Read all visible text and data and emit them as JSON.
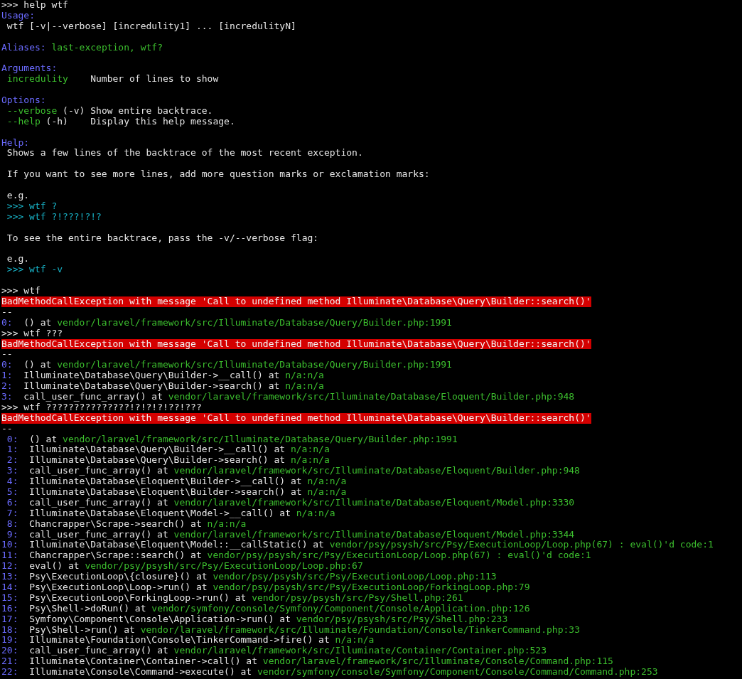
{
  "terminal": {
    "lines": [
      {
        "kind": "text",
        "segments": [
          {
            "kind": "plain",
            "text": ">>> help wtf"
          }
        ]
      },
      {
        "kind": "text",
        "segments": [
          {
            "kind": "heading",
            "text": "Usage:"
          }
        ]
      },
      {
        "kind": "text",
        "indent": true,
        "segments": [
          {
            "kind": "plain",
            "text": "wtf [-v|--verbose] [incredulity1] ... [incredulityN]"
          }
        ]
      },
      {
        "kind": "blank"
      },
      {
        "kind": "text",
        "segments": [
          {
            "kind": "heading",
            "text": "Aliases:"
          },
          {
            "kind": "green",
            "text": " last-exception, wtf?"
          }
        ]
      },
      {
        "kind": "blank"
      },
      {
        "kind": "text",
        "segments": [
          {
            "kind": "heading",
            "text": "Arguments:"
          }
        ]
      },
      {
        "kind": "text",
        "indent": true,
        "segments": [
          {
            "kind": "green",
            "text": "incredulity"
          },
          {
            "kind": "plain",
            "text": "    Number of lines to show"
          }
        ]
      },
      {
        "kind": "blank"
      },
      {
        "kind": "text",
        "segments": [
          {
            "kind": "heading",
            "text": "Options:"
          }
        ]
      },
      {
        "kind": "text",
        "indent": true,
        "segments": [
          {
            "kind": "green",
            "text": "--verbose"
          },
          {
            "kind": "plain",
            "text": " (-v) Show entire backtrace."
          }
        ]
      },
      {
        "kind": "text",
        "indent": true,
        "segments": [
          {
            "kind": "green",
            "text": "--help"
          },
          {
            "kind": "plain",
            "text": " (-h)    Display this help message."
          }
        ]
      },
      {
        "kind": "blank"
      },
      {
        "kind": "text",
        "segments": [
          {
            "kind": "heading",
            "text": "Help:"
          }
        ]
      },
      {
        "kind": "text",
        "indent": true,
        "segments": [
          {
            "kind": "plain",
            "text": "Shows a few lines of the backtrace of the most recent exception."
          }
        ]
      },
      {
        "kind": "blank"
      },
      {
        "kind": "text",
        "indent": true,
        "segments": [
          {
            "kind": "plain",
            "text": "If you want to see more lines, add more question marks or exclamation marks:"
          }
        ]
      },
      {
        "kind": "blank"
      },
      {
        "kind": "text",
        "indent": true,
        "segments": [
          {
            "kind": "plain",
            "text": "e.g."
          }
        ]
      },
      {
        "kind": "text",
        "indent": true,
        "segments": [
          {
            "kind": "cyan",
            "text": ">>> wtf ?"
          }
        ]
      },
      {
        "kind": "text",
        "indent": true,
        "segments": [
          {
            "kind": "cyan",
            "text": ">>> wtf ?!???!?!?"
          }
        ]
      },
      {
        "kind": "blank"
      },
      {
        "kind": "text",
        "indent": true,
        "segments": [
          {
            "kind": "plain",
            "text": "To see the entire backtrace, pass the -v/--verbose flag:"
          }
        ]
      },
      {
        "kind": "blank"
      },
      {
        "kind": "text",
        "indent": true,
        "segments": [
          {
            "kind": "plain",
            "text": "e.g."
          }
        ]
      },
      {
        "kind": "text",
        "indent": true,
        "segments": [
          {
            "kind": "cyan",
            "text": ">>> wtf -v"
          }
        ]
      },
      {
        "kind": "blank"
      },
      {
        "kind": "text",
        "segments": [
          {
            "kind": "plain",
            "text": ">>> wtf"
          }
        ]
      },
      {
        "kind": "error",
        "text": "BadMethodCallException with message 'Call to undefined method Illuminate\\Database\\Query\\Builder::search()'"
      },
      {
        "kind": "text",
        "segments": [
          {
            "kind": "plain",
            "text": "--"
          }
        ]
      },
      {
        "kind": "frame",
        "padded": false,
        "index": "0:",
        "call": "() at",
        "location": "vendor/laravel/framework/src/Illuminate/Database/Query/Builder.php:1991"
      },
      {
        "kind": "text",
        "segments": [
          {
            "kind": "plain",
            "text": ">>> wtf ???"
          }
        ]
      },
      {
        "kind": "error",
        "text": "BadMethodCallException with message 'Call to undefined method Illuminate\\Database\\Query\\Builder::search()'"
      },
      {
        "kind": "text",
        "segments": [
          {
            "kind": "plain",
            "text": "--"
          }
        ]
      },
      {
        "kind": "frame",
        "padded": false,
        "index": "0:",
        "call": "() at",
        "location": "vendor/laravel/framework/src/Illuminate/Database/Query/Builder.php:1991"
      },
      {
        "kind": "frame",
        "padded": false,
        "index": "1:",
        "call": "Illuminate\\Database\\Query\\Builder->__call() at",
        "location": "n/a:n/a"
      },
      {
        "kind": "frame",
        "padded": false,
        "index": "2:",
        "call": "Illuminate\\Database\\Query\\Builder->search() at",
        "location": "n/a:n/a"
      },
      {
        "kind": "frame",
        "padded": false,
        "index": "3:",
        "call": "call_user_func_array() at",
        "location": "vendor/laravel/framework/src/Illuminate/Database/Eloquent/Builder.php:948"
      },
      {
        "kind": "text",
        "segments": [
          {
            "kind": "plain",
            "text": ">>> wtf ???????????????!?!?!?!??!???"
          }
        ]
      },
      {
        "kind": "error",
        "text": "BadMethodCallException with message 'Call to undefined method Illuminate\\Database\\Query\\Builder::search()'"
      },
      {
        "kind": "text",
        "segments": [
          {
            "kind": "plain",
            "text": "--"
          }
        ]
      },
      {
        "kind": "frame",
        "padded": true,
        "index": "0:",
        "call": "() at",
        "location": "vendor/laravel/framework/src/Illuminate/Database/Query/Builder.php:1991"
      },
      {
        "kind": "frame",
        "padded": true,
        "index": "1:",
        "call": "Illuminate\\Database\\Query\\Builder->__call() at",
        "location": "n/a:n/a"
      },
      {
        "kind": "frame",
        "padded": true,
        "index": "2:",
        "call": "Illuminate\\Database\\Query\\Builder->search() at",
        "location": "n/a:n/a"
      },
      {
        "kind": "frame",
        "padded": true,
        "index": "3:",
        "call": "call_user_func_array() at",
        "location": "vendor/laravel/framework/src/Illuminate/Database/Eloquent/Builder.php:948"
      },
      {
        "kind": "frame",
        "padded": true,
        "index": "4:",
        "call": "Illuminate\\Database\\Eloquent\\Builder->__call() at",
        "location": "n/a:n/a"
      },
      {
        "kind": "frame",
        "padded": true,
        "index": "5:",
        "call": "Illuminate\\Database\\Eloquent\\Builder->search() at",
        "location": "n/a:n/a"
      },
      {
        "kind": "frame",
        "padded": true,
        "index": "6:",
        "call": "call_user_func_array() at",
        "location": "vendor/laravel/framework/src/Illuminate/Database/Eloquent/Model.php:3330"
      },
      {
        "kind": "frame",
        "padded": true,
        "index": "7:",
        "call": "Illuminate\\Database\\Eloquent\\Model->__call() at",
        "location": "n/a:n/a"
      },
      {
        "kind": "frame",
        "padded": true,
        "index": "8:",
        "call": "Chancrapper\\Scrape->search() at",
        "location": "n/a:n/a"
      },
      {
        "kind": "frame",
        "padded": true,
        "index": "9:",
        "call": "call_user_func_array() at",
        "location": "vendor/laravel/framework/src/Illuminate/Database/Eloquent/Model.php:3344"
      },
      {
        "kind": "frame",
        "padded": false,
        "index": "10:",
        "call": "Illuminate\\Database\\Eloquent\\Model::__callStatic() at",
        "location": "vendor/psy/psysh/src/Psy/ExecutionLoop/Loop.php(67) : eval()'d code:1"
      },
      {
        "kind": "frame",
        "padded": false,
        "index": "11:",
        "call": "Chancrapper\\Scrape::search() at",
        "location": "vendor/psy/psysh/src/Psy/ExecutionLoop/Loop.php(67) : eval()'d code:1"
      },
      {
        "kind": "frame",
        "padded": false,
        "index": "12:",
        "call": "eval() at",
        "location": "vendor/psy/psysh/src/Psy/ExecutionLoop/Loop.php:67"
      },
      {
        "kind": "frame",
        "padded": false,
        "index": "13:",
        "call": "Psy\\ExecutionLoop\\{closure}() at",
        "location": "vendor/psy/psysh/src/Psy/ExecutionLoop/Loop.php:113"
      },
      {
        "kind": "frame",
        "padded": false,
        "index": "14:",
        "call": "Psy\\ExecutionLoop\\Loop->run() at",
        "location": "vendor/psy/psysh/src/Psy/ExecutionLoop/ForkingLoop.php:79"
      },
      {
        "kind": "frame",
        "padded": false,
        "index": "15:",
        "call": "Psy\\ExecutionLoop\\ForkingLoop->run() at",
        "location": "vendor/psy/psysh/src/Psy/Shell.php:261"
      },
      {
        "kind": "frame",
        "padded": false,
        "index": "16:",
        "call": "Psy\\Shell->doRun() at",
        "location": "vendor/symfony/console/Symfony/Component/Console/Application.php:126"
      },
      {
        "kind": "frame",
        "padded": false,
        "index": "17:",
        "call": "Symfony\\Component\\Console\\Application->run() at",
        "location": "vendor/psy/psysh/src/Psy/Shell.php:233"
      },
      {
        "kind": "frame",
        "padded": false,
        "index": "18:",
        "call": "Psy\\Shell->run() at",
        "location": "vendor/laravel/framework/src/Illuminate/Foundation/Console/TinkerCommand.php:33"
      },
      {
        "kind": "frame",
        "padded": false,
        "index": "19:",
        "call": "Illuminate\\Foundation\\Console\\TinkerCommand->fire() at",
        "location": "n/a:n/a"
      },
      {
        "kind": "frame",
        "padded": false,
        "index": "20:",
        "call": "call_user_func_array() at",
        "location": "vendor/laravel/framework/src/Illuminate/Container/Container.php:523"
      },
      {
        "kind": "frame",
        "padded": false,
        "index": "21:",
        "call": "Illuminate\\Container\\Container->call() at",
        "location": "vendor/laravel/framework/src/Illuminate/Console/Command.php:115"
      },
      {
        "kind": "frame",
        "padded": false,
        "index": "22:",
        "call": "Illuminate\\Console\\Command->execute() at",
        "location": "vendor/symfony/console/Symfony/Component/Console/Command/Command.php:253"
      }
    ]
  }
}
